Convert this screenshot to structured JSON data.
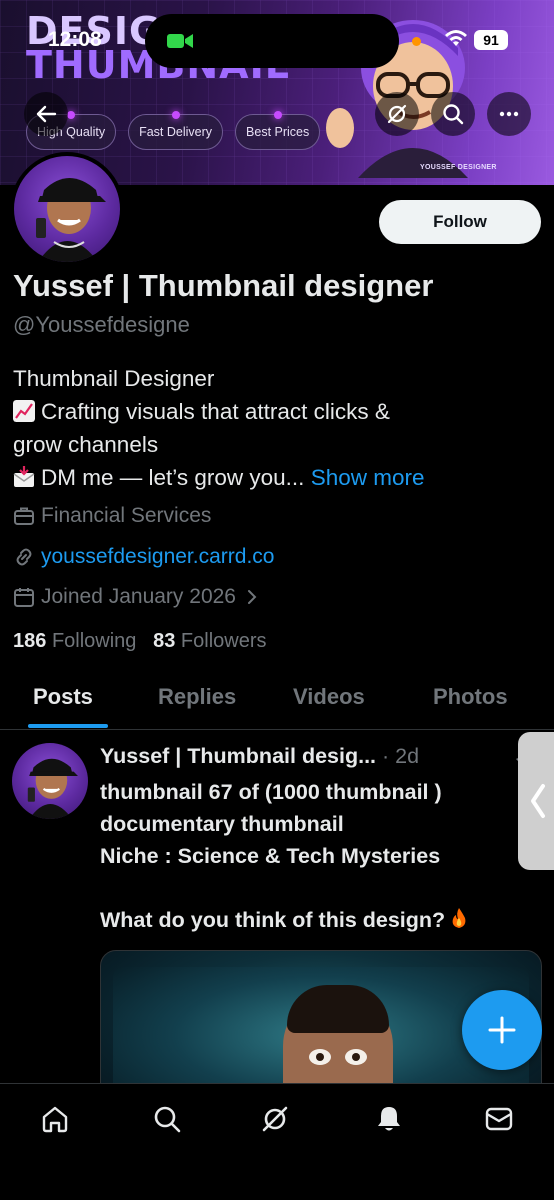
{
  "status_bar": {
    "time": "12:08",
    "battery": "91"
  },
  "banner": {
    "title_line1": "DESIG",
    "title_line2": "THUMBNAIL",
    "tags": [
      "High Quality",
      "Fast Delivery",
      "Best Prices"
    ],
    "signature": "YOUSSEF DESIGNER"
  },
  "header_icons": [
    "back-arrow-icon",
    "grok-icon",
    "search-icon",
    "more-icon"
  ],
  "profile": {
    "follow_label": "Follow",
    "display_name": "Yussef | Thumbnail designer",
    "handle": "@Youssefdesigne",
    "bio_line1": "Thumbnail Designer",
    "bio_line2": "Crafting visuals that attract clicks &",
    "bio_line3": "grow channels",
    "bio_line4": "DM me — let’s grow you...",
    "show_more": "Show more",
    "category": "Financial Services",
    "website": "youssefdesigner.carrd.co",
    "joined": "Joined January 2026",
    "following_count": "186",
    "following_label": "Following",
    "followers_count": "83",
    "followers_label": "Followers"
  },
  "tabs": [
    {
      "label": "Posts",
      "active": true
    },
    {
      "label": "Replies",
      "active": false
    },
    {
      "label": "Videos",
      "active": false
    },
    {
      "label": "Photos",
      "active": false
    }
  ],
  "post": {
    "author": "Yussef | Thumbnail desig...",
    "time": "· 2d",
    "text": "thumbnail 67 of  (1000 thumbnail )\n documentary thumbnail\nNiche : Science & Tech Mysteries\n\nWhat do you think of this design?"
  },
  "bottom_nav": [
    "home-icon",
    "search-icon",
    "grok-icon",
    "notifications-icon",
    "messages-icon"
  ],
  "colors": {
    "accent": "#1d9bf0",
    "background": "#000000",
    "secondary_text": "#71767b",
    "primary_text": "#e7e9ea"
  }
}
